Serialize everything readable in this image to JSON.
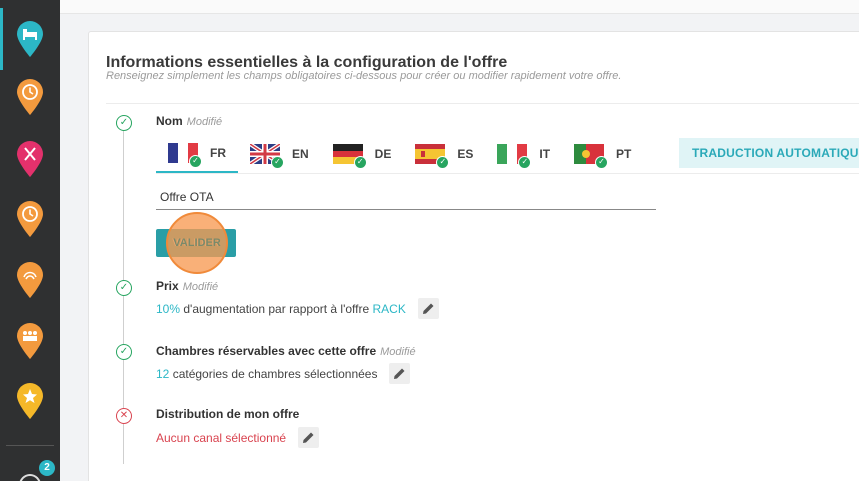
{
  "sidebar": {
    "icons": [
      {
        "name": "hotel-bed-icon",
        "color": "#2cb7c6",
        "active": true
      },
      {
        "name": "clock-icon",
        "color": "#f39a3e",
        "active": false
      },
      {
        "name": "restaurant-icon",
        "color": "#e3316c",
        "active": false
      },
      {
        "name": "clock-icon",
        "color": "#f39a3e",
        "active": false
      },
      {
        "name": "spa-icon",
        "color": "#f39a3e",
        "active": false
      },
      {
        "name": "meeting-icon",
        "color": "#f39a3e",
        "active": false
      },
      {
        "name": "star-icon",
        "color": "#f5b829",
        "active": false
      }
    ],
    "badge": "2"
  },
  "card": {
    "title": "Informations essentielles à la configuration de l'offre",
    "subtitle": "Renseignez simplement les champs obligatoires ci-dessous pour créer ou modifier rapidement votre offre."
  },
  "name_section": {
    "label": "Nom",
    "modified": "Modifié",
    "languages": [
      {
        "code": "FR",
        "active": true
      },
      {
        "code": "EN",
        "active": false
      },
      {
        "code": "DE",
        "active": false
      },
      {
        "code": "ES",
        "active": false
      },
      {
        "code": "IT",
        "active": false
      },
      {
        "code": "PT",
        "active": false
      }
    ],
    "auto_translate": "TRADUCTION AUTOMATIQUE",
    "input_value": "Offre OTA",
    "validate_label": "VALIDER"
  },
  "price_section": {
    "label": "Prix",
    "modified": "Modifié",
    "value_number": "10%",
    "value_text": " d'augmentation par rapport à l'offre ",
    "value_ref": "RACK"
  },
  "rooms_section": {
    "label": "Chambres réservables avec cette offre",
    "modified": "Modifié",
    "value_number": "12",
    "value_text": " catégories de chambres sélectionnées"
  },
  "distribution_section": {
    "label": "Distribution de mon offre",
    "value_text": "Aucun canal sélectionné"
  },
  "colors": {
    "accent": "#2cb7c6",
    "success": "#27a560",
    "error": "#d9434f",
    "sidebar_bg": "#2f3031"
  }
}
